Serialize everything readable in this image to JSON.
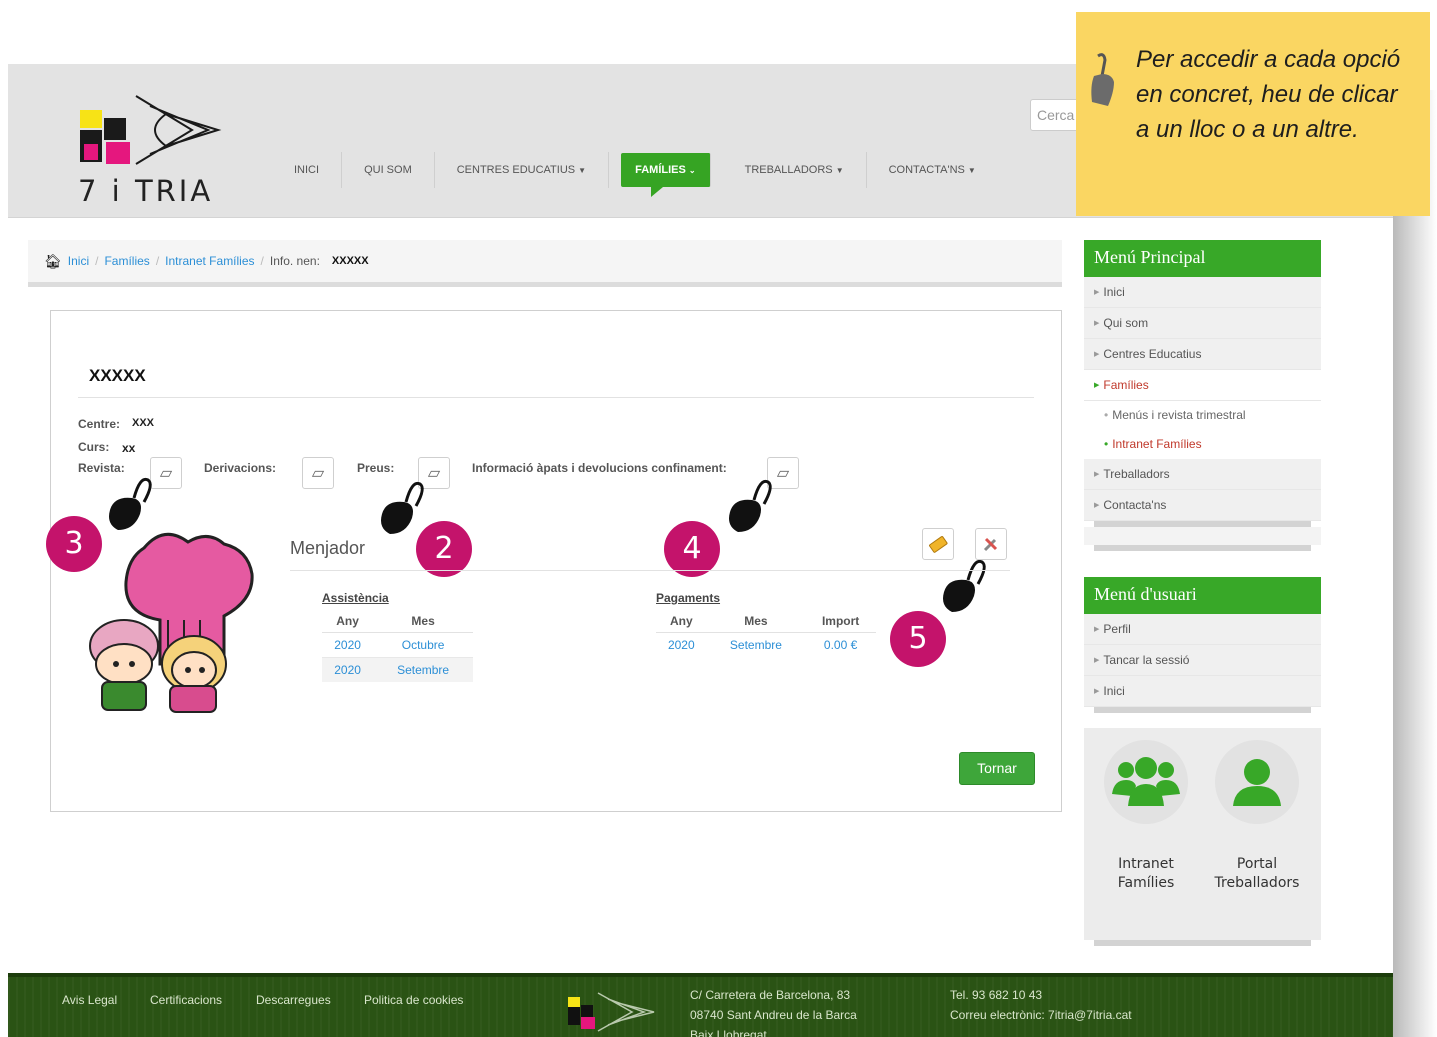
{
  "header": {
    "logo_text": "7 i TRIA",
    "search_placeholder": "Cerca",
    "nav": [
      "INICI",
      "QUI SOM",
      "CENTRES EDUCATIUS",
      "FAMÍLIES",
      "TREBALLADORS",
      "CONTACTA'NS"
    ],
    "active_nav": "FAMÍLIES"
  },
  "note": {
    "text": "Per accedir a cada opció en concret, heu de clicar a un lloc o a un altre."
  },
  "breadcrumb": {
    "items": [
      "Inici",
      "Famílies",
      "Intranet Famílies"
    ],
    "current": "Info. nen:",
    "child": "XXXXX"
  },
  "child": {
    "name": "XXXXX",
    "centre_label": "Centre:",
    "centre_value": "XXX",
    "curs_label": "Curs:",
    "curs_value": "xx",
    "docs": {
      "revista": "Revista:",
      "derivacions": "Derivacions:",
      "preus": "Preus:",
      "informacio": "Informació àpats i devolucions confinament:"
    }
  },
  "menjador": {
    "title": "Menjador",
    "assistencia": {
      "title": "Assistència",
      "headers": [
        "Any",
        "Mes"
      ],
      "rows": [
        [
          "2020",
          "Octubre"
        ],
        [
          "2020",
          "Setembre"
        ]
      ]
    },
    "pagaments": {
      "title": "Pagaments",
      "headers": [
        "Any",
        "Mes",
        "Import"
      ],
      "rows": [
        [
          "2020",
          "Setembre",
          "0.00 €"
        ]
      ]
    }
  },
  "badges": [
    "3",
    "2",
    "4",
    "5"
  ],
  "buttons": {
    "tornar": "Tornar"
  },
  "sidebar": {
    "main_title": "Menú Principal",
    "main_items": [
      "Inici",
      "Qui som",
      "Centres Educatius",
      "Famílies"
    ],
    "families_sub": [
      "Menús i revista trimestral",
      "Intranet Famílies"
    ],
    "main_items_after": [
      "Treballadors",
      "Contacta'ns"
    ],
    "user_title": "Menú d'usuari",
    "user_items": [
      "Perfil",
      "Tancar la sessió",
      "Inici"
    ],
    "quick": [
      {
        "line1": "Intranet",
        "line2": "Famílies"
      },
      {
        "line1": "Portal",
        "line2": "Treballadors"
      }
    ]
  },
  "footer": {
    "links": [
      "Avis Legal",
      "Certificacions",
      "Descarregues",
      "Politica de cookies"
    ],
    "address": [
      "C/ Carretera de Barcelona, 83",
      "08740 Sant Andreu de la Barca",
      "Baix Llobregat"
    ],
    "tel": "Tel. 93 682 10 43",
    "email": "Correu electrònic: 7itria@7itria.cat"
  },
  "colors": {
    "green": "#38a828",
    "magenta": "#c4136b",
    "note_yellow": "#fad662",
    "footer_green": "#2a5314"
  }
}
